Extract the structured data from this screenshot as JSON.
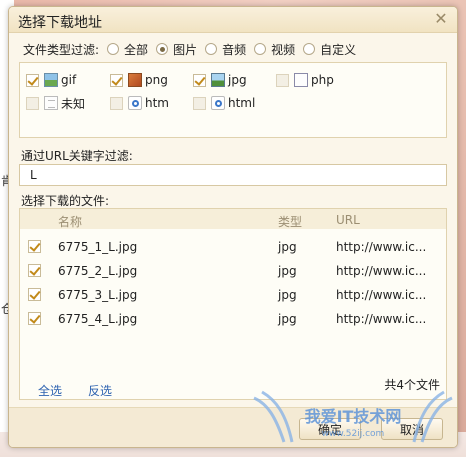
{
  "background": {
    "fragments": [
      "肯",
      "仓"
    ]
  },
  "dialog": {
    "title": "选择下载地址",
    "close_glyph": "✕",
    "filter_label": "文件类型过滤:",
    "categories": [
      {
        "label": "全部",
        "selected": false
      },
      {
        "label": "图片",
        "selected": true
      },
      {
        "label": "音频",
        "selected": false
      },
      {
        "label": "视频",
        "selected": false
      },
      {
        "label": "自定义",
        "selected": false
      }
    ],
    "file_types": [
      {
        "label": "gif",
        "checked": true,
        "enabled": true,
        "icon": "gif-file-icon"
      },
      {
        "label": "png",
        "checked": true,
        "enabled": true,
        "icon": "png-file-icon"
      },
      {
        "label": "jpg",
        "checked": true,
        "enabled": true,
        "icon": "jpg-file-icon"
      },
      {
        "label": "php",
        "checked": false,
        "enabled": false,
        "icon": "php-file-icon"
      },
      {
        "label": "未知",
        "checked": false,
        "enabled": false,
        "icon": "unknown-file-icon"
      },
      {
        "label": "htm",
        "checked": false,
        "enabled": false,
        "icon": "htm-file-icon"
      },
      {
        "label": "html",
        "checked": false,
        "enabled": false,
        "icon": "html-file-icon"
      }
    ],
    "url_filter_label": "通过URL关键字过滤:",
    "url_filter_value": "L",
    "files_label": "选择下载的文件:",
    "table": {
      "headers": {
        "name": "名称",
        "type": "类型",
        "url": "URL"
      },
      "rows": [
        {
          "name": "6775_1_L.jpg",
          "type": "jpg",
          "url": "http://www.ic...",
          "checked": true
        },
        {
          "name": "6775_2_L.jpg",
          "type": "jpg",
          "url": "http://www.ic...",
          "checked": true
        },
        {
          "name": "6775_3_L.jpg",
          "type": "jpg",
          "url": "http://www.ic...",
          "checked": true
        },
        {
          "name": "6775_4_L.jpg",
          "type": "jpg",
          "url": "http://www.ic...",
          "checked": true
        }
      ]
    },
    "select_all": "全选",
    "invert_selection": "反选",
    "total_count": "共4个文件",
    "buttons": {
      "ok": "确定",
      "cancel": "取消"
    }
  },
  "watermark": {
    "text": "我爱IT技术网",
    "url": "www.52ij.com"
  },
  "colors": {
    "accent_check": "#c28a1a",
    "link": "#2d62b0",
    "dialog_bg": "#fbf6ea"
  }
}
